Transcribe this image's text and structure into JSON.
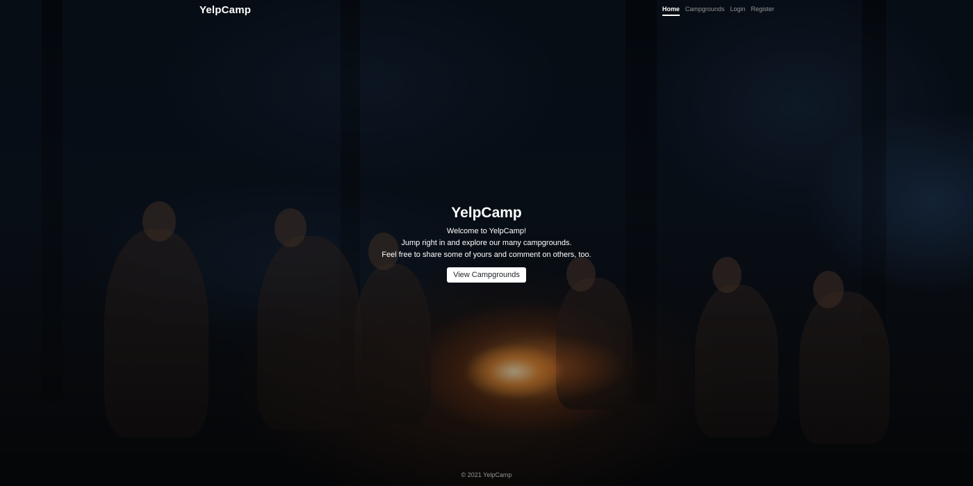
{
  "navbar": {
    "brand": "YelpCamp",
    "links": [
      {
        "label": "Home",
        "active": true
      },
      {
        "label": "Campgrounds",
        "active": false
      },
      {
        "label": "Login",
        "active": false
      },
      {
        "label": "Register",
        "active": false
      }
    ]
  },
  "hero": {
    "title": "YelpCamp",
    "lines": [
      "Welcome to YelpCamp!",
      "Jump right in and explore our many campgrounds.",
      "Feel free to share some of yours and comment on others, too."
    ],
    "button_label": "View Campgrounds"
  },
  "footer": {
    "text": "© 2021 YelpCamp"
  }
}
